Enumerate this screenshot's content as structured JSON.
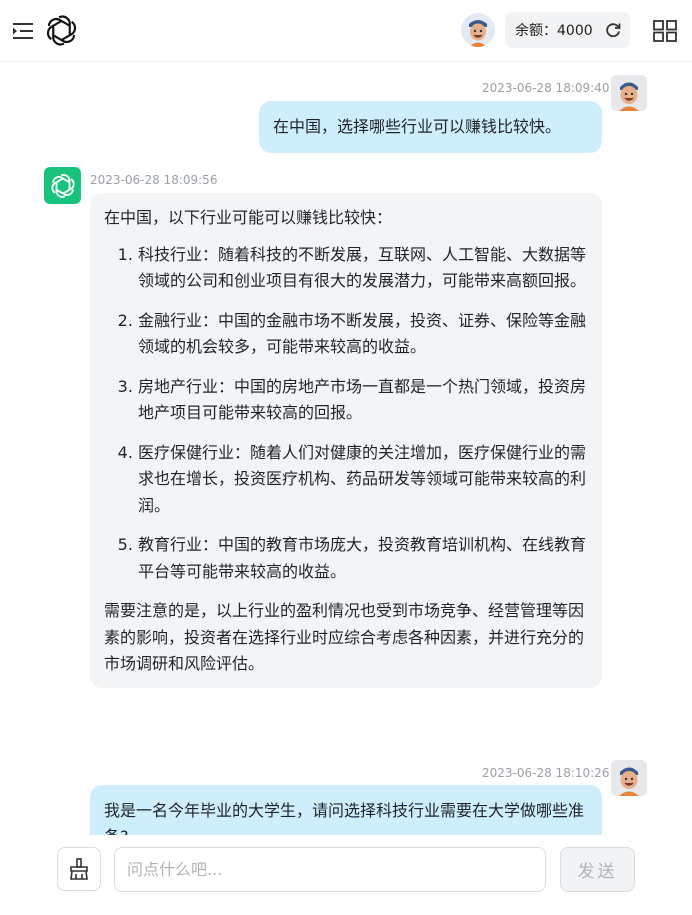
{
  "header": {
    "balance_label": "余额：4000",
    "icons": [
      "menu-icon",
      "openai-logo-icon",
      "user-avatar",
      "refresh-icon",
      "grid-icon"
    ]
  },
  "messages": [
    {
      "role": "user",
      "timestamp": "2023-06-28 18:09:40",
      "text": "在中国，选择哪些行业可以赚钱比较快。"
    },
    {
      "role": "assistant",
      "timestamp": "2023-06-28 18:09:56",
      "intro": "在中国，以下行业可能可以赚钱比较快：",
      "items": [
        "科技行业：随着科技的不断发展，互联网、人工智能、大数据等领域的公司和创业项目有很大的发展潜力，可能带来高额回报。",
        "金融行业：中国的金融市场不断发展，投资、证券、保险等金融领域的机会较多，可能带来较高的收益。",
        "房地产行业：中国的房地产市场一直都是一个热门领域，投资房地产项目可能带来较高的回报。",
        "医疗保健行业：随着人们对健康的关注增加，医疗保健行业的需求也在增长，投资医疗机构、药品研发等领域可能带来较高的利润。",
        "教育行业：中国的教育市场庞大，投资教育培训机构、在线教育平台等可能带来较高的收益。"
      ],
      "outro": "需要注意的是，以上行业的盈利情况也受到市场竞争、经营管理等因素的影响，投资者在选择行业时应综合考虑各种因素，并进行充分的市场调研和风险评估。"
    },
    {
      "role": "user",
      "timestamp": "2023-06-28 18:10:26",
      "text": "我是一名今年毕业的大学生，请问选择科技行业需要在大学做哪些准备?"
    }
  ],
  "input": {
    "placeholder": "问点什么吧...",
    "value": "",
    "send_label": "发送"
  },
  "colors": {
    "user_bubble": "#cfeefc",
    "bot_bubble": "#f3f4f6",
    "bot_avatar": "#19c37d"
  }
}
